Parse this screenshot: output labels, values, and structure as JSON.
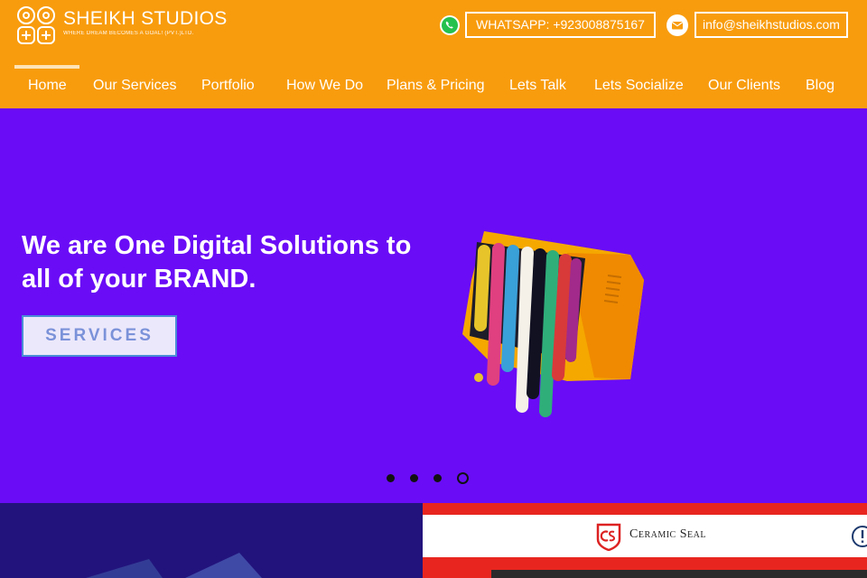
{
  "brand": {
    "name": "SHEIKH STUDIOS",
    "tagline": "WHERE DREAM BECOMES A GOAL! (PVT.)LTD."
  },
  "contact": {
    "whatsapp_label": "WHATSAPP: +923008875167",
    "email_label": "info@sheikhstudios.com"
  },
  "nav": {
    "items": [
      {
        "label": "Home",
        "active": true
      },
      {
        "label": "Our Services"
      },
      {
        "label": "Portfolio"
      },
      {
        "label": "How We Do"
      },
      {
        "label": "Plans & Pricing"
      },
      {
        "label": "Lets Talk"
      },
      {
        "label": "Lets Socialize"
      },
      {
        "label": "Our Clients"
      },
      {
        "label": "Blog"
      }
    ]
  },
  "hero": {
    "headline": "We are One Digital Solutions to all of your BRAND.",
    "button_label": "SERVICES",
    "slides": 4,
    "active_slide": 4
  },
  "featured": {
    "client_name": "Ceramic Seal"
  },
  "colors": {
    "header": "#f89c0e",
    "hero": "#6a0cf6",
    "lower_left": "#22137c",
    "lower_right": "#e8261f"
  },
  "icons": [
    "logo-mark-icon",
    "whatsapp-icon",
    "mail-icon",
    "ceramic-seal-logo-icon",
    "info-icon"
  ]
}
